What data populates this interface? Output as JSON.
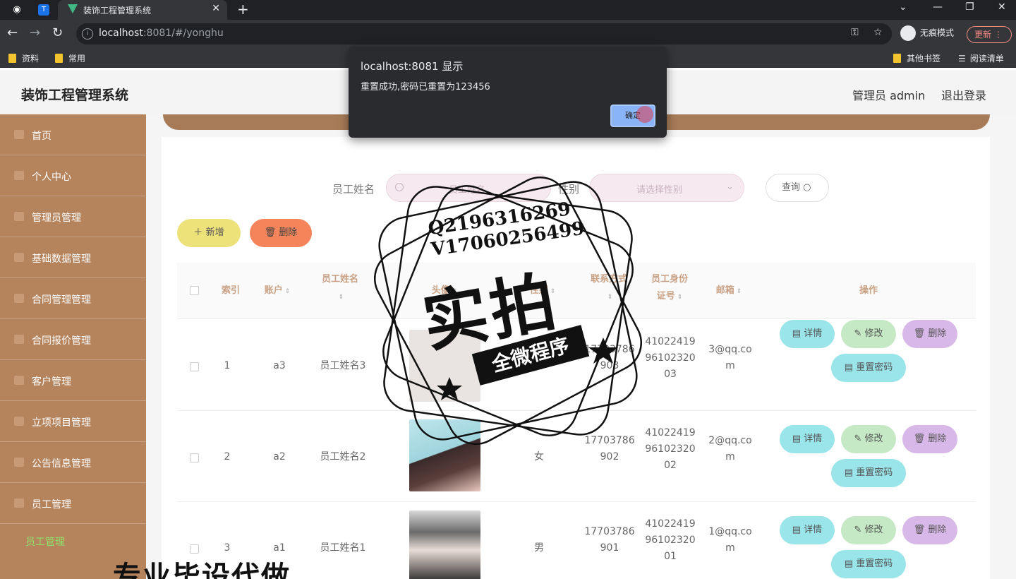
{
  "browser": {
    "tab_title": "装饰工程管理系统",
    "url_host": "localhost",
    "url_path": ":8081/#/yonghu",
    "incognito_label": "无痕模式",
    "update_label": "更新",
    "bookmarks": [
      "资料",
      "常用"
    ],
    "bookmarks_right": [
      "其他书签",
      "阅读清单"
    ]
  },
  "header": {
    "title": "装饰工程管理系统",
    "admin": "管理员 admin",
    "logout": "退出登录"
  },
  "sidebar": {
    "items": [
      {
        "label": "首页"
      },
      {
        "label": "个人中心"
      },
      {
        "label": "管理员管理"
      },
      {
        "label": "基础数据管理"
      },
      {
        "label": "合同管理管理"
      },
      {
        "label": "合同报价管理"
      },
      {
        "label": "客户管理"
      },
      {
        "label": "立项项目管理"
      },
      {
        "label": "公告信息管理"
      },
      {
        "label": "员工管理"
      }
    ],
    "active_sub": "员工管理"
  },
  "search": {
    "name_label": "员工姓名",
    "name_placeholder": "员工姓名",
    "gender_label": "性别",
    "gender_placeholder": "请选择性别",
    "query_label": "查询"
  },
  "actions": {
    "add": "新增",
    "delete": "删除"
  },
  "table": {
    "headers": {
      "index": "索引",
      "account": "账户",
      "name": "员工姓名",
      "avatar": "头像",
      "gender": "性别",
      "phone": "联系方式",
      "idcard_line1": "员工身份",
      "idcard_line2": "证号",
      "email": "邮箱",
      "ops": "操作"
    },
    "rows": [
      {
        "index": "1",
        "account": "a3",
        "name": "员工姓名3",
        "gender": "男",
        "phone1": "17703786",
        "phone2": "903",
        "id1": "41022419",
        "id2": "96102320",
        "id3": "03",
        "email1": "3@qq.co",
        "email2": "m"
      },
      {
        "index": "2",
        "account": "a2",
        "name": "员工姓名2",
        "gender": "女",
        "phone1": "17703786",
        "phone2": "902",
        "id1": "41022419",
        "id2": "96102320",
        "id3": "02",
        "email1": "2@qq.co",
        "email2": "m"
      },
      {
        "index": "3",
        "account": "a1",
        "name": "员工姓名1",
        "gender": "男",
        "phone1": "17703786",
        "phone2": "901",
        "id1": "41022419",
        "id2": "96102320",
        "id3": "01",
        "email1": "1@qq.co",
        "email2": "m"
      }
    ],
    "op_labels": {
      "detail": "详情",
      "edit": "修改",
      "delete": "删除",
      "reset": "重置密码"
    }
  },
  "dialog": {
    "title": "localhost:8081 显示",
    "message": "重置成功,密码已重置为123456",
    "ok": "确定"
  },
  "watermark": {
    "q": "Q2196316269",
    "v": "V17060256499",
    "big": "实拍",
    "ribbon": "全微程序",
    "bottom": "专业毕设代做"
  }
}
